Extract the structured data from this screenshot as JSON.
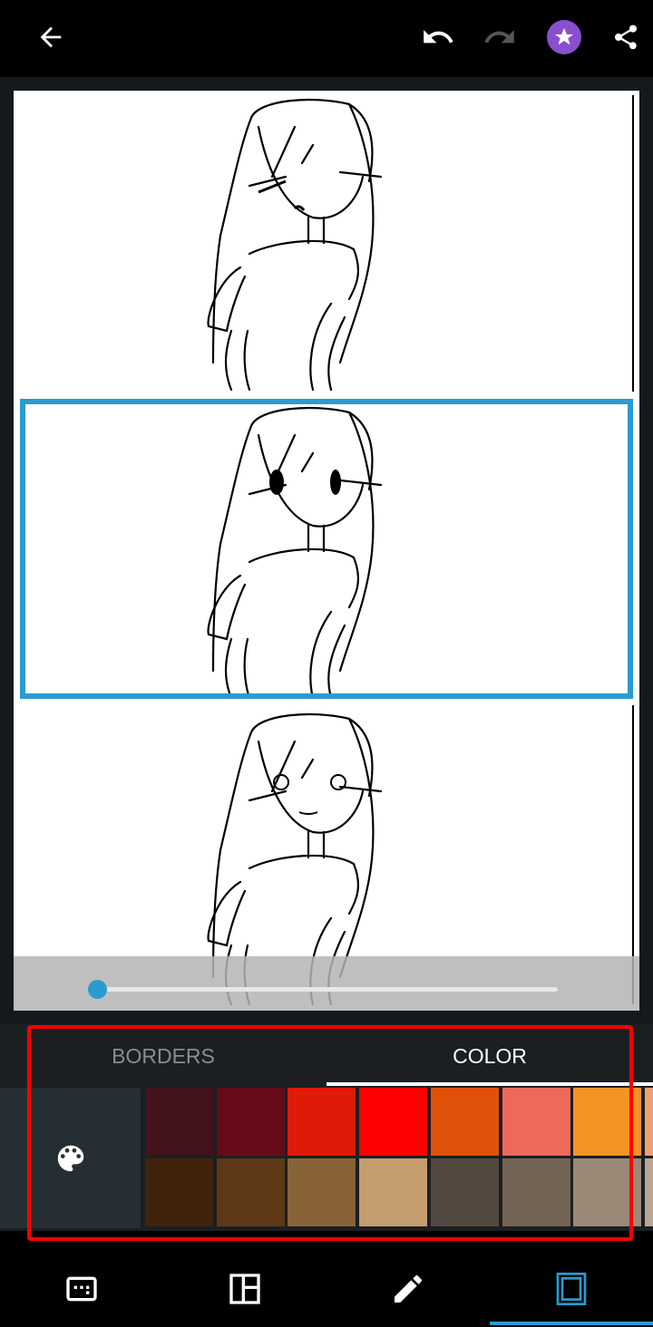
{
  "toolbar": {
    "back": "back-arrow-icon",
    "undo": "undo-icon",
    "redo": "redo-icon",
    "premium": "star-icon",
    "share": "share-icon",
    "premium_color": "#8a4fcf"
  },
  "frames": [
    {
      "selected": false
    },
    {
      "selected": true
    },
    {
      "selected": false
    }
  ],
  "slider": {
    "value": 0
  },
  "tabs": [
    {
      "label": "BORDERS",
      "active": false
    },
    {
      "label": "COLOR",
      "active": true
    }
  ],
  "palette": {
    "row1": [
      "#43121b",
      "#660b18",
      "#df1a08",
      "#ff0000",
      "#e0520a",
      "#ef695a",
      "#f59324",
      "#f0a070"
    ],
    "row2": [
      "#40230c",
      "#5f3915",
      "#8a6238",
      "#c49c6e",
      "#524840",
      "#736456",
      "#9a8977",
      "#b7a792"
    ]
  },
  "bottom_nav": [
    {
      "icon": "caption-icon"
    },
    {
      "icon": "layout-icon"
    },
    {
      "icon": "pencil-icon"
    },
    {
      "icon": "border-icon",
      "active": true
    }
  ],
  "accent": "#2a9bd1"
}
